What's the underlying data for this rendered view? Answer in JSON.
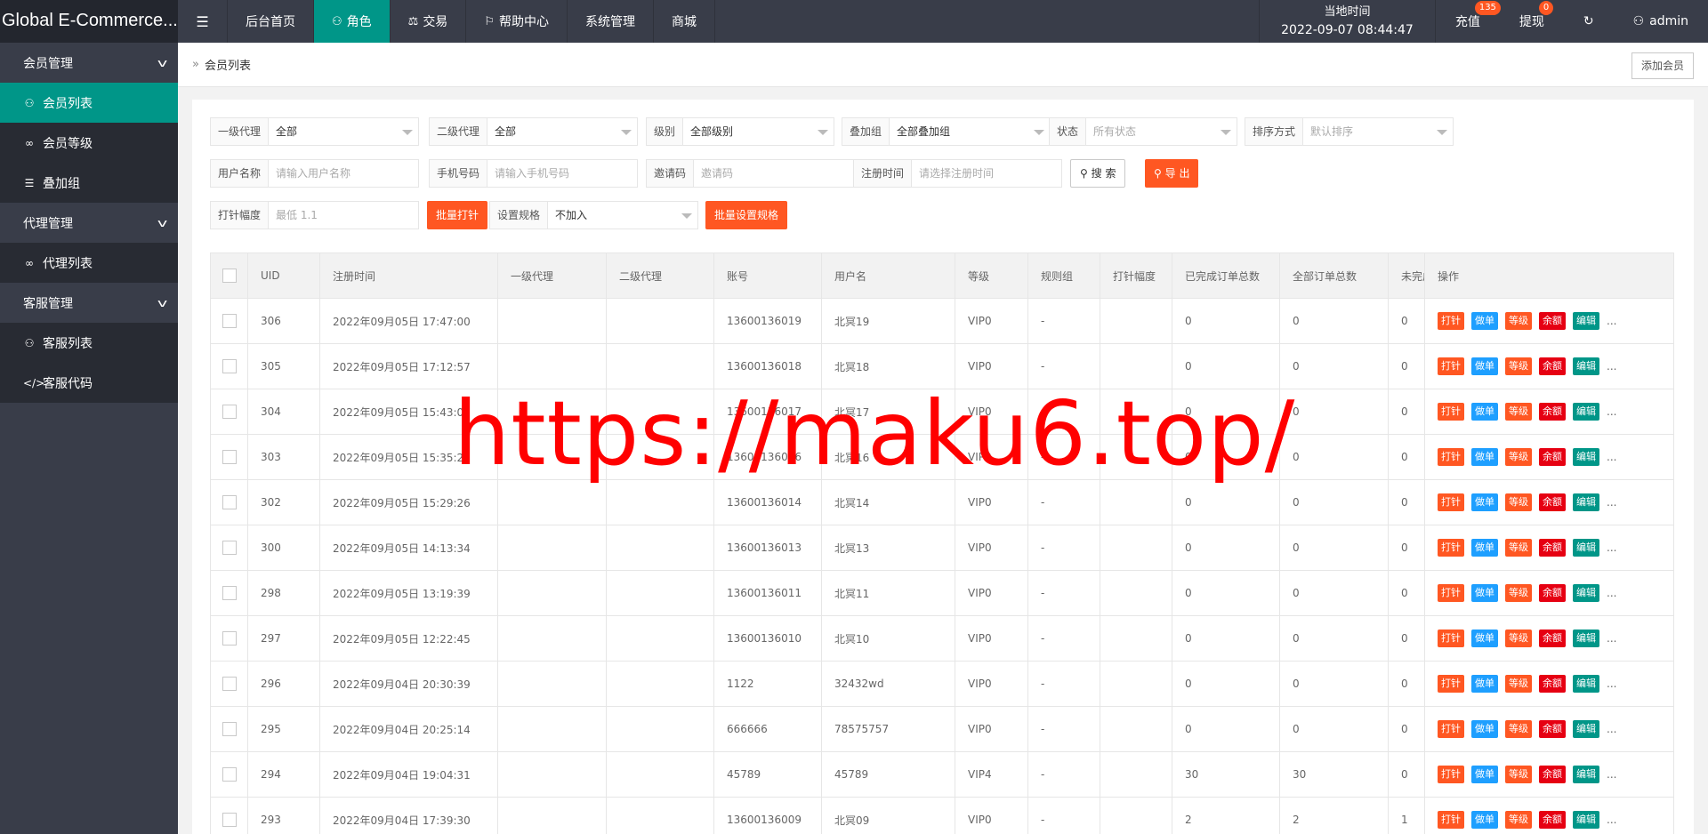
{
  "app": {
    "title": "Global E-Commerce..."
  },
  "nav": {
    "menu_icon": "☰",
    "items": [
      {
        "label": "后台首页",
        "icon": ""
      },
      {
        "label": "角色",
        "icon": "user-icon"
      },
      {
        "label": "交易",
        "icon": "scale-icon"
      },
      {
        "label": "帮助中心",
        "icon": "flag-icon"
      },
      {
        "label": "系统管理",
        "icon": ""
      },
      {
        "label": "商城",
        "icon": ""
      }
    ]
  },
  "topright": {
    "clock_label": "当地时间",
    "clock_value": "2022-09-07 08:44:47",
    "recharge": "充值",
    "recharge_badge": "135",
    "withdraw": "提现",
    "withdraw_badge": "0",
    "refresh_icon": "↻",
    "admin": "admin"
  },
  "sidebar": {
    "groups": [
      {
        "label": "会员管理",
        "items": [
          {
            "label": "会员列表",
            "icon": "user-icon",
            "active": true
          },
          {
            "label": "会员等级",
            "icon": "link-icon"
          },
          {
            "label": "叠加组",
            "icon": "list-icon"
          }
        ]
      },
      {
        "label": "代理管理",
        "items": [
          {
            "label": "代理列表",
            "icon": "link-icon"
          }
        ]
      },
      {
        "label": "客服管理",
        "items": [
          {
            "label": "客服列表",
            "icon": "users-icon"
          },
          {
            "label": "客服代码",
            "icon": "code-icon"
          }
        ]
      }
    ]
  },
  "breadcrumb": {
    "label": "会员列表",
    "add_button": "添加会员"
  },
  "filters": {
    "agent1": {
      "label": "一级代理",
      "value": "全部"
    },
    "agent2": {
      "label": "二级代理",
      "value": "全部"
    },
    "level": {
      "label": "级别",
      "value": "全部级别"
    },
    "group": {
      "label": "叠加组",
      "value": "全部叠加组"
    },
    "status": {
      "label": "状态",
      "placeholder": "所有状态"
    },
    "sort": {
      "label": "排序方式",
      "placeholder": "默认排序"
    },
    "username": {
      "label": "用户名称",
      "placeholder": "请输入用户名称"
    },
    "phone": {
      "label": "手机号码",
      "placeholder": "请输入手机号码"
    },
    "invite": {
      "label": "邀请码",
      "placeholder": "邀请码"
    },
    "regtime": {
      "label": "注册时间",
      "placeholder": "请选择注册时间"
    },
    "search_button": "搜 索",
    "export_button": "导 出",
    "needle": {
      "label": "打针幅度",
      "placeholder": "最低 1.1"
    },
    "batch_needle_button": "批量打针",
    "spec": {
      "label": "设置规格",
      "value": "不加入"
    },
    "batch_spec_button": "批量设置规格"
  },
  "table": {
    "headers": [
      "UID",
      "注册时间",
      "一级代理",
      "二级代理",
      "账号",
      "用户名",
      "等级",
      "规则组",
      "打针幅度",
      "已完成订单总数",
      "全部订单总数",
      "未完成",
      "操作"
    ],
    "action_labels": [
      "打针",
      "做单",
      "等级",
      "余额",
      "编辑"
    ],
    "more": "...",
    "rows": [
      {
        "uid": "306",
        "time": "2022年09月05日 17:47:00",
        "a1": "",
        "a2": "",
        "account": "13600136019",
        "name": "北冥19",
        "level": "VIP0",
        "rule": "-",
        "needle": "",
        "done": "0",
        "total": "0",
        "undone": "0"
      },
      {
        "uid": "305",
        "time": "2022年09月05日 17:12:57",
        "a1": "",
        "a2": "",
        "account": "13600136018",
        "name": "北冥18",
        "level": "VIP0",
        "rule": "-",
        "needle": "",
        "done": "0",
        "total": "0",
        "undone": "0"
      },
      {
        "uid": "304",
        "time": "2022年09月05日 15:43:09",
        "a1": "",
        "a2": "",
        "account": "13600136017",
        "name": "北冥17",
        "level": "VIP0",
        "rule": "-",
        "needle": "",
        "done": "0",
        "total": "0",
        "undone": "0"
      },
      {
        "uid": "303",
        "time": "2022年09月05日 15:35:20",
        "a1": "",
        "a2": "",
        "account": "13600136016",
        "name": "北冥16",
        "level": "VIP0",
        "rule": "-",
        "needle": "",
        "done": "0",
        "total": "0",
        "undone": "0"
      },
      {
        "uid": "302",
        "time": "2022年09月05日 15:29:26",
        "a1": "",
        "a2": "",
        "account": "13600136014",
        "name": "北冥14",
        "level": "VIP0",
        "rule": "-",
        "needle": "",
        "done": "0",
        "total": "0",
        "undone": "0"
      },
      {
        "uid": "300",
        "time": "2022年09月05日 14:13:34",
        "a1": "",
        "a2": "",
        "account": "13600136013",
        "name": "北冥13",
        "level": "VIP0",
        "rule": "-",
        "needle": "",
        "done": "0",
        "total": "0",
        "undone": "0"
      },
      {
        "uid": "298",
        "time": "2022年09月05日 13:19:39",
        "a1": "",
        "a2": "",
        "account": "13600136011",
        "name": "北冥11",
        "level": "VIP0",
        "rule": "-",
        "needle": "",
        "done": "0",
        "total": "0",
        "undone": "0"
      },
      {
        "uid": "297",
        "time": "2022年09月05日 12:22:45",
        "a1": "",
        "a2": "",
        "account": "13600136010",
        "name": "北冥10",
        "level": "VIP0",
        "rule": "-",
        "needle": "",
        "done": "0",
        "total": "0",
        "undone": "0"
      },
      {
        "uid": "296",
        "time": "2022年09月04日 20:30:39",
        "a1": "",
        "a2": "",
        "account": "1122",
        "name": "32432wd",
        "level": "VIP0",
        "rule": "-",
        "needle": "",
        "done": "0",
        "total": "0",
        "undone": "0"
      },
      {
        "uid": "295",
        "time": "2022年09月04日 20:25:14",
        "a1": "",
        "a2": "",
        "account": "666666",
        "name": "78575757",
        "level": "VIP0",
        "rule": "-",
        "needle": "",
        "done": "0",
        "total": "0",
        "undone": "0"
      },
      {
        "uid": "294",
        "time": "2022年09月04日 19:04:31",
        "a1": "",
        "a2": "",
        "account": "45789",
        "name": "45789",
        "level": "VIP4",
        "rule": "-",
        "needle": "",
        "done": "30",
        "total": "30",
        "undone": "0"
      },
      {
        "uid": "293",
        "time": "2022年09月04日 17:39:30",
        "a1": "",
        "a2": "",
        "account": "13600136009",
        "name": "北冥09",
        "level": "VIP0",
        "rule": "-",
        "needle": "",
        "done": "2",
        "total": "2",
        "undone": "1"
      }
    ]
  },
  "watermark": "https://maku6.top/",
  "colors": {
    "topbar": "#393d49",
    "accent": "#009688",
    "orange": "#ff5722",
    "blue": "#1e9fff",
    "red": "#e60012"
  }
}
